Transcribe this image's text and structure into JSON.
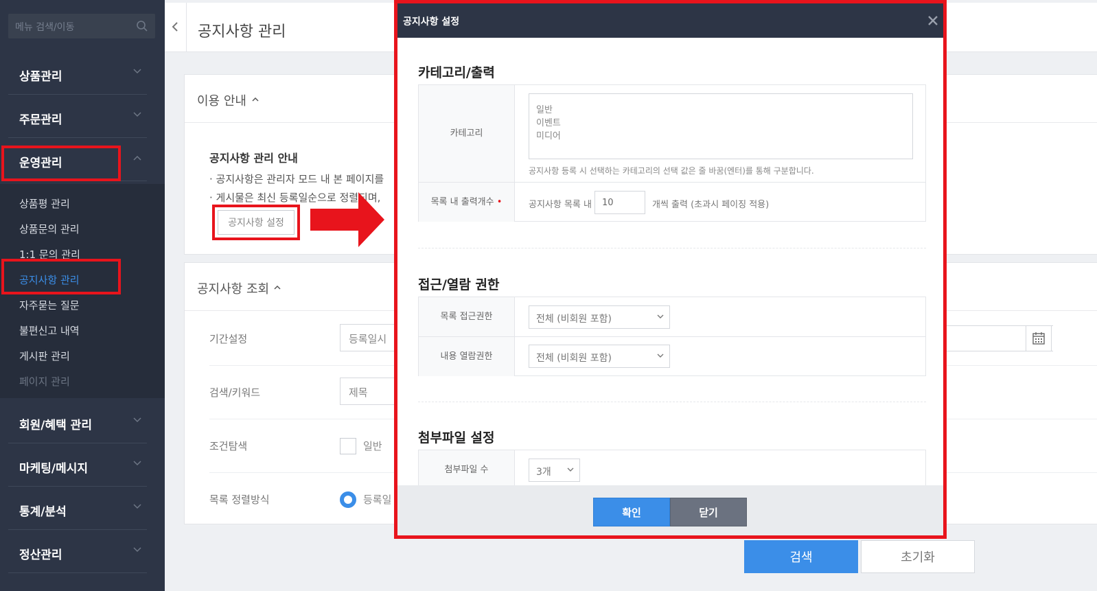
{
  "sidebar": {
    "search_placeholder": "메뉴 검색/이동",
    "menus": [
      {
        "label": "상품관리"
      },
      {
        "label": "주문관리"
      },
      {
        "label": "운영관리"
      },
      {
        "label": "회원/혜택 관리"
      },
      {
        "label": "마케팅/메시지"
      },
      {
        "label": "통계/분석"
      },
      {
        "label": "정산관리"
      }
    ],
    "submenu": [
      {
        "label": "상품평 관리"
      },
      {
        "label": "상품문의 관리"
      },
      {
        "label": "1:1 문의 관리"
      },
      {
        "label": "공지사항 관리"
      },
      {
        "label": "자주묻는 질문"
      },
      {
        "label": "불편신고 내역"
      },
      {
        "label": "게시판 관리"
      },
      {
        "label": "페이지 관리"
      }
    ]
  },
  "page": {
    "title": "공지사항 관리"
  },
  "guide": {
    "header": "이용 안내",
    "title": "공지사항 관리 안내",
    "lines": [
      "· 공지사항은 관리자 모드 내 본 페이지를",
      "· 게시물은 최신 등록일순으로 정렬되며,"
    ],
    "button_label": "공지사항 설정"
  },
  "search_panel": {
    "header": "공지사항 조회",
    "rows": [
      {
        "label": "기간설정",
        "value": "등록일시"
      },
      {
        "label": "검색/키워드",
        "value": "제목"
      },
      {
        "label": "조건탐색",
        "option": "일반"
      },
      {
        "label": "목록 정렬방식",
        "option": "등록일"
      }
    ],
    "search_button": "검색",
    "reset_button": "초기화"
  },
  "modal": {
    "title": "공지사항 설정",
    "category_section": {
      "title": "카테고리/출력",
      "category_label": "카테고리",
      "category_lines": [
        "일반",
        "이벤트",
        "미디어"
      ],
      "category_hint": "공지사항 등록 시 선택하는 카테고리의 선택 값은 줄 바꿈(엔터)를 통해 구분합니다.",
      "list_count_label": "목록 내 출력개수",
      "required_mark": "•",
      "list_prefix": "공지사항 목록 내",
      "list_count_value": "10",
      "list_suffix": "개씩 출력 (초과시 페이징 적용)"
    },
    "access_section": {
      "title": "접근/열람 권한",
      "list_access_label": "목록 접근권한",
      "list_access_value": "전체 (비회원 포함)",
      "read_access_label": "내용 열람권한",
      "read_access_value": "전체 (비회원 포함)"
    },
    "attach_section": {
      "title": "첨부파일 설정",
      "count_label": "첨부파일 수",
      "count_value": "3개"
    },
    "ok_button": "확인",
    "close_button": "닫기"
  },
  "colors": {
    "sidebar_bg": "#2d3546",
    "accent": "#3b8ee8",
    "highlight": "#e8141c"
  }
}
